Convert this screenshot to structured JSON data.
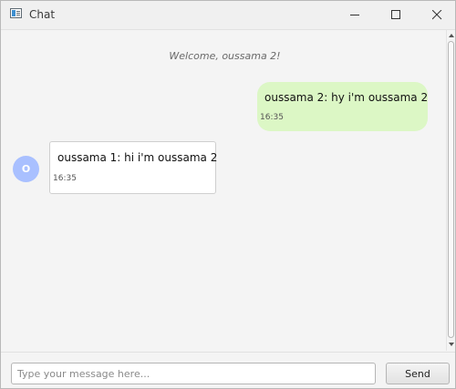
{
  "window": {
    "title": "Chat"
  },
  "chat": {
    "welcome": "Welcome, oussama 2!",
    "messages": [
      {
        "direction": "outgoing",
        "text": "oussama 2: hy i'm  oussama 2",
        "time": "16:35"
      },
      {
        "direction": "incoming",
        "avatar_initial": "O",
        "text": "oussama 1: hi i'm oussama 2",
        "time": "16:35"
      }
    ]
  },
  "composer": {
    "placeholder": "Type your message here...",
    "value": "",
    "send_label": "Send"
  },
  "colors": {
    "outgoing_bubble": "#dcf7c5",
    "incoming_bubble": "#ffffff",
    "avatar": "#a9c0ff"
  },
  "icons": [
    "app-window-icon",
    "minimize-icon",
    "maximize-icon",
    "close-icon"
  ]
}
